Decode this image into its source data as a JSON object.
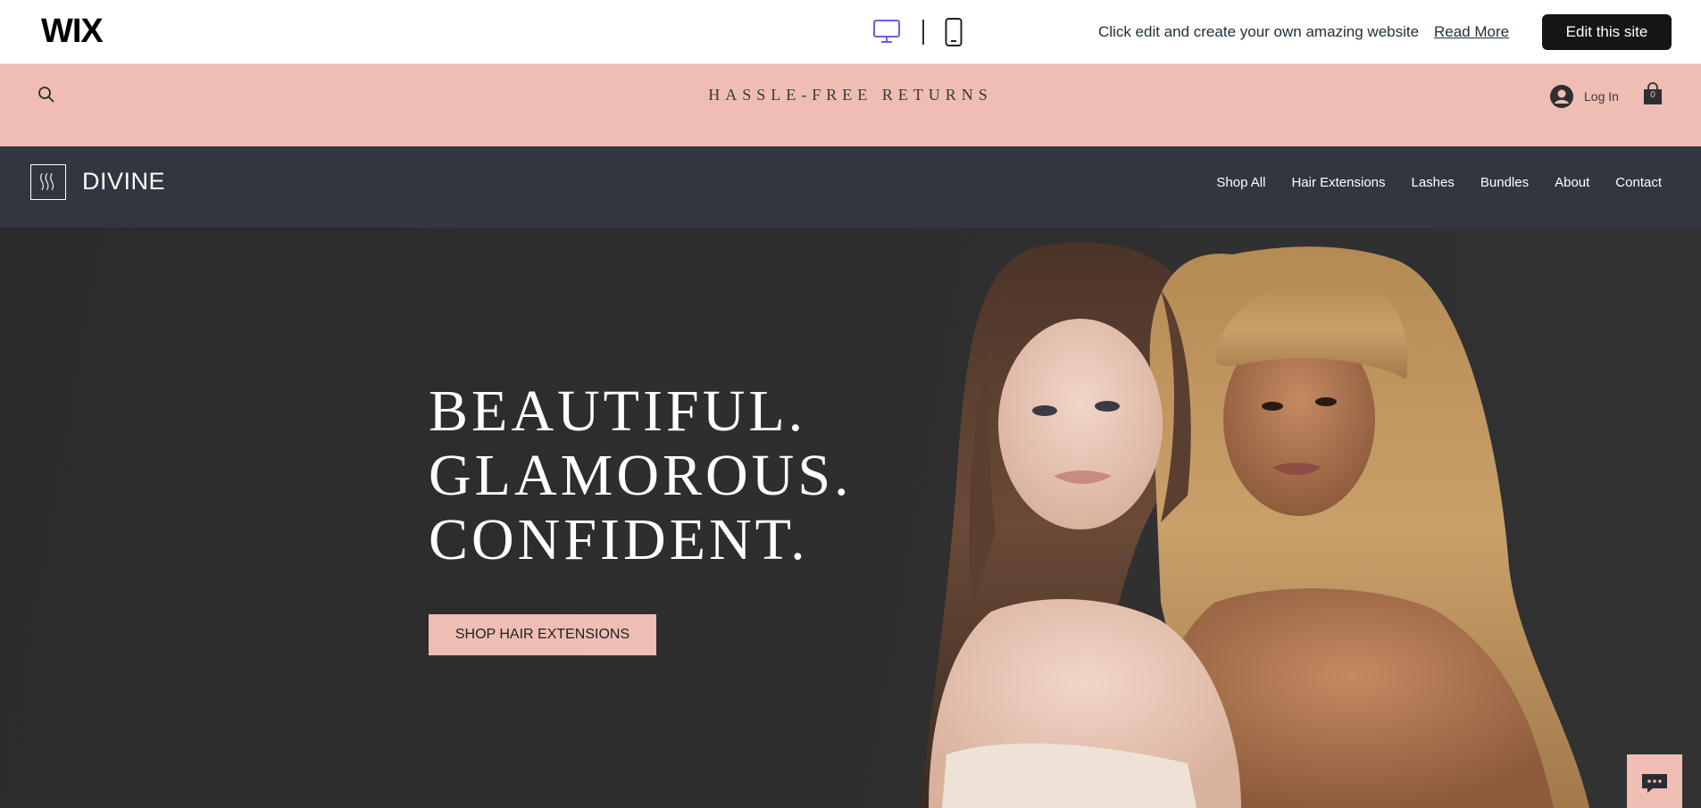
{
  "wix_bar": {
    "logo": "WIX",
    "desktop_icon": "desktop-monitor-icon",
    "mobile_icon": "mobile-phone-icon",
    "message": "Click edit and create your own amazing website",
    "read_more": "Read More",
    "edit_button": "Edit this site",
    "accent_color": "#6f5ce8"
  },
  "announcement": {
    "text": "HASSLE-FREE RETURNS",
    "background": "#efbdb3",
    "search_icon": "search-icon",
    "login_label": "Log In",
    "cart_count": "0"
  },
  "site_header": {
    "brand": "DIVINE",
    "background": "#323640",
    "nav": [
      "Shop All",
      "Hair Extensions",
      "Lashes",
      "Bundles",
      "About",
      "Contact"
    ]
  },
  "hero": {
    "title_lines": [
      "BEAUTIFUL.",
      "GLAMOROUS.",
      "CONFIDENT."
    ],
    "cta": "SHOP HAIR EXTENSIONS",
    "cta_color": "#efbdb3"
  },
  "chat_widget": {
    "icon": "chat-bubble-icon"
  }
}
